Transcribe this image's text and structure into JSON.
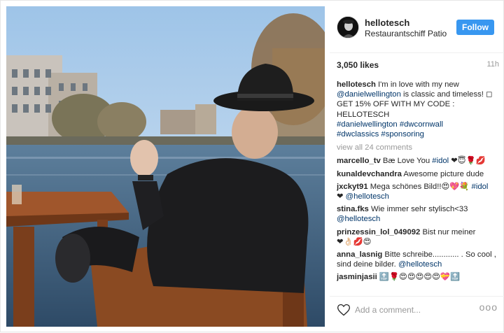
{
  "post": {
    "username": "hellotesch",
    "location": "Restaurantschiff Patio",
    "follow_label": "Follow",
    "likes": "3,050 likes",
    "time": "11h"
  },
  "caption": {
    "user": "hellotesch",
    "line1": " I'm in love with my new ",
    "mention": "@danielwellington",
    "line2": " is classic and timeless! ◻",
    "promo": "GET 15% OFF WITH MY CODE : HELLOTESCH",
    "tags": [
      "#danielwellington",
      "#dwcornwall",
      "#dwclassics",
      "#sponsoring"
    ]
  },
  "view_all": "view all 24 comments",
  "comments": [
    {
      "user": "marcello_tv",
      "text": " Bæ Love You ",
      "tag": "#idol",
      "tail": " ❤😇🌹💋"
    },
    {
      "user": "kunaldevchandra",
      "text": " Awesome picture dude",
      "tag": "",
      "tail": ""
    },
    {
      "user": "jxckyt91",
      "text": " Mega schönes Bild!!😍💖💐 ",
      "tag": "#idol",
      "tail": ""
    },
    {
      "user": "",
      "text": "",
      "tag": "@hellotesch",
      "tail": "",
      "prefix": "❤ "
    },
    {
      "user": "stina.fks",
      "text": " Wie immer sehr stylisch<33",
      "tag": "",
      "tail": ""
    },
    {
      "user": "",
      "text": "",
      "tag": "@hellotesch",
      "tail": ""
    },
    {
      "user": "prinzessin_lol_049092",
      "text": " Bist nur meiner",
      "tag": "",
      "tail": ""
    },
    {
      "user": "",
      "text": "❤👌🏻💋😍",
      "tag": "",
      "tail": ""
    },
    {
      "user": "anna_lasnig",
      "text": " Bitte schreibe............ . So cool , sind deine bilder. ",
      "tag": "@hellotesch",
      "tail": ""
    },
    {
      "user": "jasminjasii",
      "text": " 🔝🌹😍😍😍😍😍💝🔝",
      "tag": "",
      "tail": ""
    }
  ],
  "add_comment_placeholder": "Add a comment...",
  "more_label": "ooo",
  "colors": {
    "follow": "#3897f0",
    "link": "#003569",
    "muted": "#999999"
  },
  "icons": [
    "heart-icon",
    "more-options-icon",
    "avatar"
  ]
}
